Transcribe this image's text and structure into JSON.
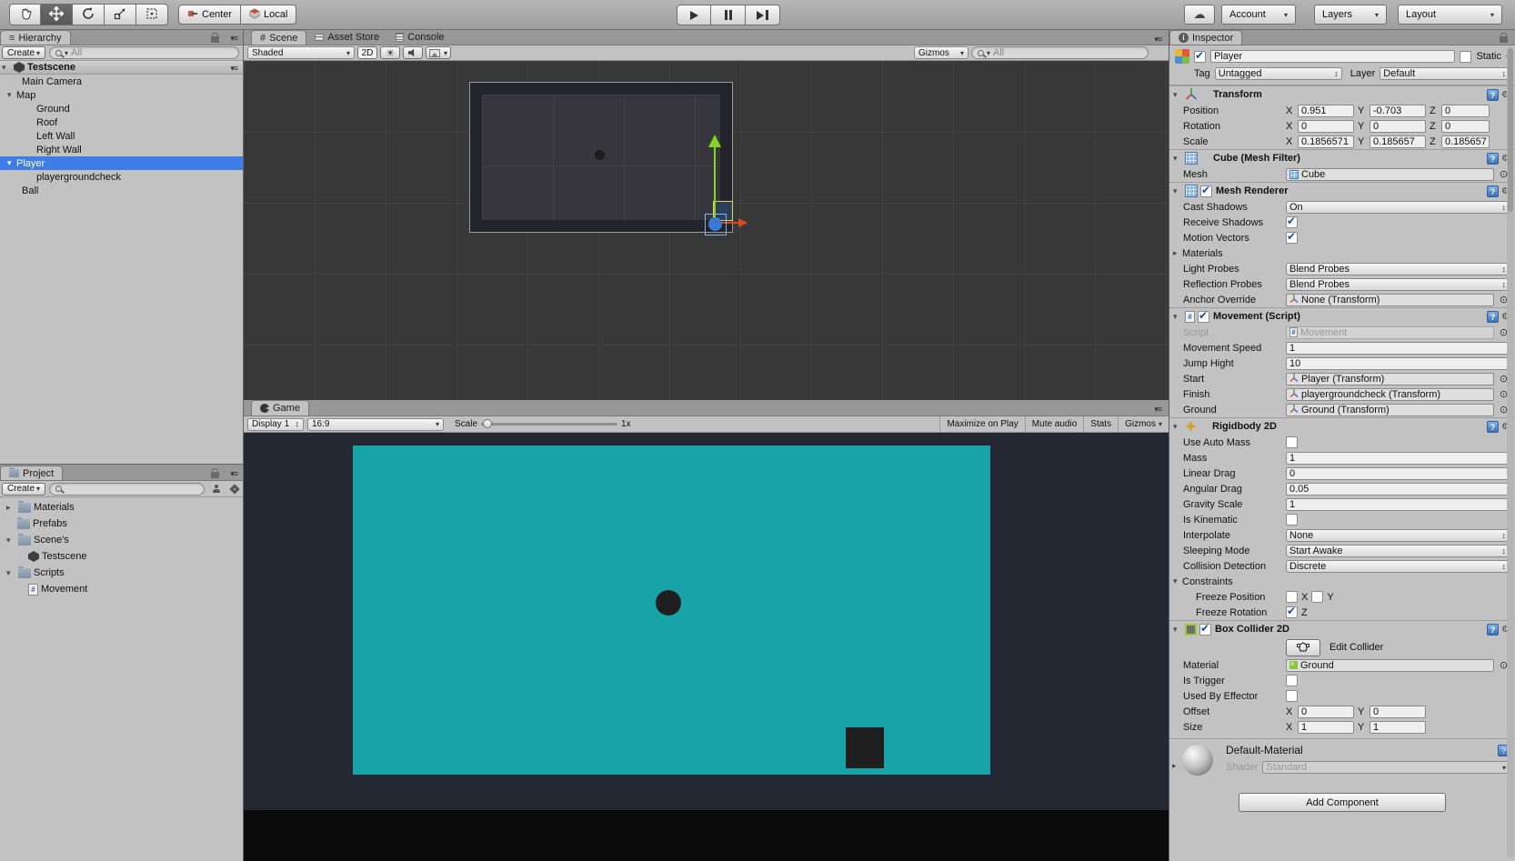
{
  "toolbar": {
    "tool_icons": [
      "hand-tool",
      "move-tool",
      "rotate-tool",
      "scale-tool",
      "rect-tool"
    ],
    "active_tool": "move-tool",
    "center_label": "Center",
    "local_label": "Local",
    "play_icons": [
      "play",
      "pause",
      "step"
    ],
    "cloud_icon": "☁",
    "account_label": "Account",
    "layers_label": "Layers",
    "layout_label": "Layout"
  },
  "hierarchy": {
    "tab_label": "Hierarchy",
    "create_label": "Create",
    "search_placeholder": "All",
    "scene_header": "Testscene",
    "items": [
      {
        "label": "Main Camera",
        "indent": 1
      },
      {
        "label": "Map",
        "indent": 1,
        "arrow": "open"
      },
      {
        "label": "Ground",
        "indent": 2
      },
      {
        "label": "Roof",
        "indent": 2
      },
      {
        "label": "Left Wall",
        "indent": 2
      },
      {
        "label": "Right Wall",
        "indent": 2
      },
      {
        "label": "Player",
        "indent": 1,
        "arrow": "open",
        "selected": true
      },
      {
        "label": "playergroundcheck",
        "indent": 2
      },
      {
        "label": "Ball",
        "indent": 1
      }
    ]
  },
  "project": {
    "tab_label": "Project",
    "create_label": "Create",
    "search_placeholder": "",
    "items": [
      {
        "label": "Materials",
        "icon": "folder",
        "arrow": "closed",
        "indent": 0
      },
      {
        "label": "Prefabs",
        "icon": "folder",
        "indent": 0
      },
      {
        "label": "Scene's",
        "icon": "folder",
        "arrow": "open",
        "indent": 0
      },
      {
        "label": "Testscene",
        "icon": "unity-scene",
        "indent": 1
      },
      {
        "label": "Scripts",
        "icon": "folder",
        "arrow": "open",
        "indent": 0
      },
      {
        "label": "Movement",
        "icon": "csharp-script",
        "indent": 1
      }
    ]
  },
  "scene_panel": {
    "tabs": [
      {
        "label": "Scene",
        "icon": "grid-icon",
        "active": true
      },
      {
        "label": "Asset Store",
        "icon": "store-icon",
        "active": false
      },
      {
        "label": "Console",
        "icon": "console-icon",
        "active": false
      }
    ],
    "shaded_label": "Shaded",
    "mode_2d_label": "2D",
    "gizmos_label": "Gizmos",
    "search_placeholder": "All"
  },
  "game_panel": {
    "tab_label": "Game",
    "display_label": "Display 1",
    "aspect_label": "16:9",
    "scale_label": "Scale",
    "scale_value": "1x",
    "maximize_label": "Maximize on Play",
    "mute_label": "Mute audio",
    "stats_label": "Stats",
    "gizmos_label": "Gizmos"
  },
  "inspector": {
    "tab_label": "Inspector",
    "header": {
      "name": "Player",
      "static_label": "Static",
      "tag_label": "Tag",
      "tag_value": "Untagged",
      "layer_label": "Layer",
      "layer_value": "Default"
    },
    "axis_labels": [
      "X",
      "Y",
      "Z"
    ],
    "components": [
      {
        "title": "Transform",
        "icon": "transform-icon",
        "rows": [
          {
            "label": "Position",
            "type": "vec3",
            "values": [
              "0.951",
              "-0.703",
              "0"
            ]
          },
          {
            "label": "Rotation",
            "type": "vec3",
            "values": [
              "0",
              "0",
              "0"
            ]
          },
          {
            "label": "Scale",
            "type": "vec3",
            "values": [
              "0.1856571",
              "0.185657",
              "0.185657"
            ]
          }
        ]
      },
      {
        "title": "Cube (Mesh Filter)",
        "icon": "mesh-filter-icon",
        "rows": [
          {
            "label": "Mesh",
            "type": "object",
            "value": "Cube",
            "oicon": "mesh"
          }
        ]
      },
      {
        "title": "Mesh Renderer",
        "icon": "mesh-renderer-icon",
        "checkbox": true,
        "checked": true,
        "rows": [
          {
            "label": "Cast Shadows",
            "type": "enum",
            "value": "On"
          },
          {
            "label": "Receive Shadows",
            "type": "check",
            "checked": true
          },
          {
            "label": "Motion Vectors",
            "type": "check",
            "checked": true
          },
          {
            "label": "Materials",
            "type": "foldout",
            "open": false
          },
          {
            "label": "Light Probes",
            "type": "enum",
            "value": "Blend Probes"
          },
          {
            "label": "Reflection Probes",
            "type": "enum",
            "value": "Blend Probes"
          },
          {
            "label": "Anchor Override",
            "type": "object",
            "value": "None (Transform)",
            "oicon": "none"
          }
        ]
      },
      {
        "title": "Movement (Script)",
        "icon": "script-icon",
        "checkbox": true,
        "checked": true,
        "rows": [
          {
            "label": "Script",
            "type": "object",
            "value": "Movement",
            "oicon": "script",
            "disabled": true
          },
          {
            "label": "Movement Speed",
            "type": "text",
            "value": "1"
          },
          {
            "label": "Jump Hight",
            "type": "text",
            "value": "10"
          },
          {
            "label": "Start",
            "type": "object",
            "value": "Player (Transform)",
            "oicon": "transform"
          },
          {
            "label": "Finish",
            "type": "object",
            "value": "playergroundcheck (Transform)",
            "oicon": "transform"
          },
          {
            "label": "Ground",
            "type": "object",
            "value": "Ground (Transform)",
            "oicon": "transform"
          }
        ]
      },
      {
        "title": "Rigidbody 2D",
        "icon": "rigidbody2d-icon",
        "rows": [
          {
            "label": "Use Auto Mass",
            "type": "check",
            "checked": false
          },
          {
            "label": "Mass",
            "type": "text",
            "value": "1"
          },
          {
            "label": "Linear Drag",
            "type": "text",
            "value": "0"
          },
          {
            "label": "Angular Drag",
            "type": "text",
            "value": "0.05"
          },
          {
            "label": "Gravity Scale",
            "type": "text",
            "value": "1"
          },
          {
            "label": "Is Kinematic",
            "type": "check",
            "checked": false
          },
          {
            "label": "Interpolate",
            "type": "enum",
            "value": "None"
          },
          {
            "label": "Sleeping Mode",
            "type": "enum",
            "value": "Start Awake"
          },
          {
            "label": "Collision Detection",
            "type": "enum",
            "value": "Discrete"
          },
          {
            "label": "Constraints",
            "type": "foldout",
            "open": true
          },
          {
            "label": "Freeze Position",
            "type": "axes",
            "indent": true,
            "axes": [
              {
                "axis": "X",
                "checked": false
              },
              {
                "axis": "Y",
                "checked": false
              }
            ]
          },
          {
            "label": "Freeze Rotation",
            "type": "axes",
            "indent": true,
            "axes": [
              {
                "axis": "Z",
                "checked": true
              }
            ]
          }
        ]
      },
      {
        "title": "Box Collider 2D",
        "icon": "box-collider-icon",
        "checkbox": true,
        "checked": true,
        "rows": [
          {
            "label": "",
            "type": "edit-collider",
            "button_label": "Edit Collider"
          },
          {
            "label": "Material",
            "type": "object",
            "value": "Ground",
            "oicon": "physmat"
          },
          {
            "label": "Is Trigger",
            "type": "check",
            "checked": false
          },
          {
            "label": "Used By Effector",
            "type": "check",
            "checked": false
          },
          {
            "label": "Offset",
            "type": "vec2",
            "values": [
              "0",
              "0"
            ]
          },
          {
            "label": "Size",
            "type": "vec2",
            "values": [
              "1",
              "1"
            ]
          }
        ]
      }
    ],
    "material_footer": {
      "name": "Default-Material",
      "shader_label": "Shader",
      "shader_value": "Standard"
    },
    "add_component_label": "Add Component"
  },
  "colors": {
    "selection_blue": "#3E7DE7",
    "game_ground_teal": "#17A3A8",
    "scene_background": "#383838",
    "game_background": "#232832",
    "gizmo_green": "#86D51F",
    "gizmo_red": "#D84A26",
    "gizmo_yellow": "#E8D44D",
    "gizmo_blue": "#3A7AD5"
  }
}
